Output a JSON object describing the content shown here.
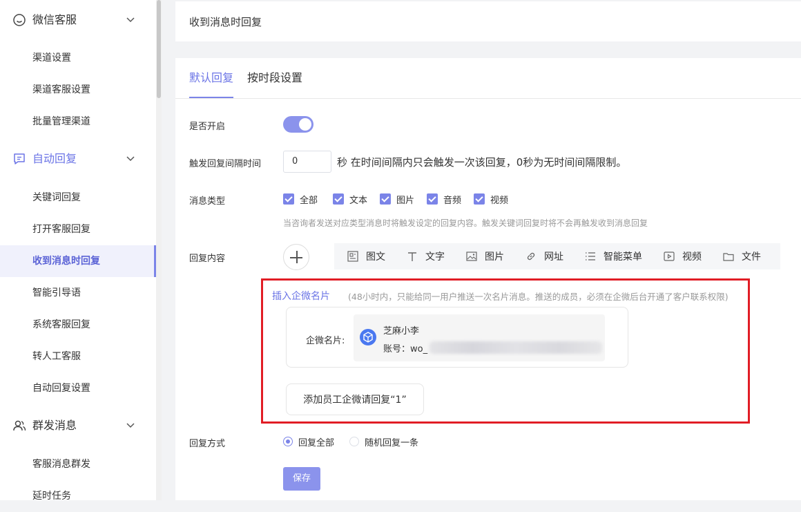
{
  "sidebar": {
    "groups": [
      {
        "label": "微信客服"
      },
      {
        "label": "自动回复"
      },
      {
        "label": "群发消息"
      }
    ],
    "items": [
      {
        "label": "渠道设置"
      },
      {
        "label": "渠道客服设置"
      },
      {
        "label": "批量管理渠道"
      },
      {
        "label": "关键词回复"
      },
      {
        "label": "打开客服回复"
      },
      {
        "label": "收到消息时回复"
      },
      {
        "label": "智能引导语"
      },
      {
        "label": "系统客服回复"
      },
      {
        "label": "转人工客服"
      },
      {
        "label": "自动回复设置"
      },
      {
        "label": "客服消息群发"
      },
      {
        "label": "延时任务"
      }
    ]
  },
  "header": {
    "title": "收到消息时回复"
  },
  "tabs": [
    {
      "label": "默认回复"
    },
    {
      "label": "按时段设置"
    }
  ],
  "form": {
    "enabled_label": "是否开启",
    "enabled": true,
    "interval_label": "触发回复间隔时间",
    "interval_value": "0",
    "interval_hint": "秒 在时间间隔内只会触发一次该回复，0秒为无时间间隔限制。",
    "msg_type_label": "消息类型",
    "msg_types": [
      {
        "label": "全部",
        "checked": true
      },
      {
        "label": "文本",
        "checked": true
      },
      {
        "label": "图片",
        "checked": true
      },
      {
        "label": "音频",
        "checked": true
      },
      {
        "label": "视频",
        "checked": true
      }
    ],
    "msg_type_hint": "当咨询者发送对应类型消息时将触发设定的回复内容。触发关键词回复时将不会再触发收到消息回复",
    "content_label": "回复内容",
    "toolbar": [
      {
        "label": "图文",
        "icon": "image-text-icon"
      },
      {
        "label": "文字",
        "icon": "text-icon"
      },
      {
        "label": "图片",
        "icon": "picture-icon"
      },
      {
        "label": "网址",
        "icon": "link-icon"
      },
      {
        "label": "智能菜单",
        "icon": "menu-icon"
      },
      {
        "label": "视频",
        "icon": "video-icon"
      },
      {
        "label": "文件",
        "icon": "file-icon"
      }
    ],
    "insert_card_link": "插入企微名片",
    "insert_card_note": "(48小时内，只能给同一用户推送一次名片消息。推送的成员，必须在企微后台开通了客户联系权限)",
    "card_label": "企微名片:",
    "card_name": "芝麻小李",
    "card_account": "账号：wo_",
    "add_staff_button": "添加员工企微请回复“1”",
    "reply_mode_label": "回复方式",
    "reply_modes": [
      {
        "label": "回复全部",
        "selected": true
      },
      {
        "label": "随机回复一条",
        "selected": false
      }
    ],
    "save_label": "保存"
  },
  "colors": {
    "accent": "#7b84e8",
    "highlight_box": "#e11d25"
  }
}
